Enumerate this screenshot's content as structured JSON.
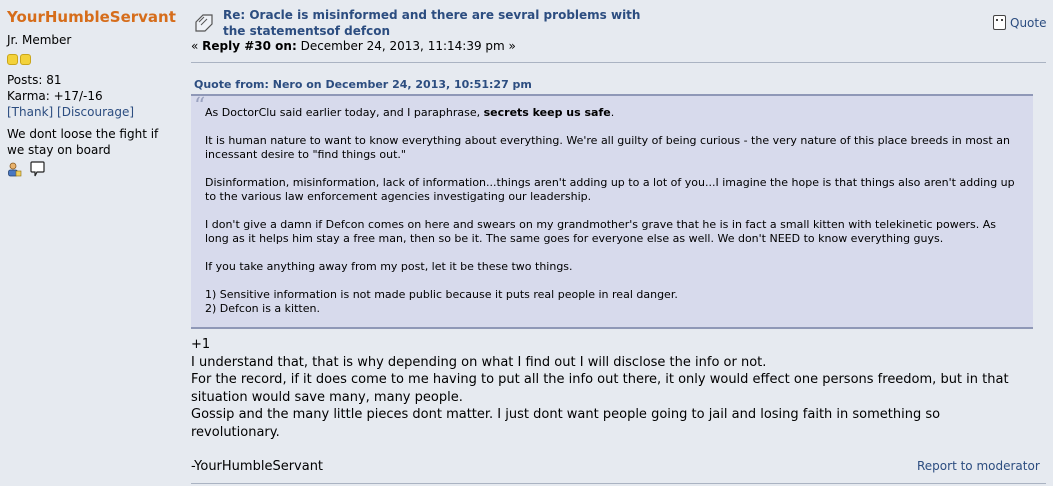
{
  "poster": {
    "name": "YourHumbleServant",
    "rank": "Jr. Member",
    "posts": "Posts: 81",
    "karma": "Karma: +17/-16",
    "thank": "[Thank]",
    "discourage": "[Discourage]",
    "personal_text": "We dont loose the fight if we stay on board",
    "icons": [
      "profile-icon",
      "message-icon"
    ]
  },
  "post": {
    "subject": "Re: Oracle is misinformed and there are sevral problems with the statementsof defcon",
    "reply_prefix": "« ",
    "reply_label": "Reply #30 on:",
    "reply_date": " December 24, 2013, 11:14:39 pm »",
    "quote_button": "Quote",
    "quote_header": "Quote from: Nero on December 24, 2013, 10:51:27 pm",
    "quote": {
      "p1_a": "As DoctorClu said earlier today, and I paraphrase, ",
      "p1_b": "secrets keep us safe",
      "p1_c": ".",
      "p2": "It is human nature to want to know everything about everything. We're all guilty of being curious - the very nature of this place breeds in most an incessant desire to \"find things out.\"",
      "p3": "Disinformation, misinformation, lack of information...things aren't adding up to a lot of you...I imagine the hope is that things also aren't adding up to the various law enforcement agencies investigating our leadership.",
      "p4": "I don't give a damn if Defcon comes on here and swears on my grandmother's grave that he is in fact a small kitten with telekinetic powers. As long as it helps him stay a free man, then so be it. The same goes for everyone else as well. We don't NEED to know everything guys.",
      "p5": "If you take anything away from my post, let it be these two things.",
      "p6a": "1) Sensitive information is not made public because it puts real people in real danger.",
      "p6b": "2) Defcon is a kitten."
    },
    "body": {
      "l1": "+1",
      "l2": "I understand that, that is why depending on what I find out I will disclose the info or not.",
      "l3": "For the record, if it does come to me having to put all the info out there, it only would effect one persons freedom, but in that situation would save many, many people.",
      "l4": "Gossip and the many little pieces dont matter. I just dont want people going to jail and losing faith in something so revolutionary.",
      "l5": "-YourHumbleServant"
    },
    "report_link": "Report to moderator"
  },
  "colors": {
    "page_bg": "#e6eaf0",
    "poster_name": "#d66d1b",
    "link": "#2c4d80",
    "quote_bg": "#d7daec"
  }
}
